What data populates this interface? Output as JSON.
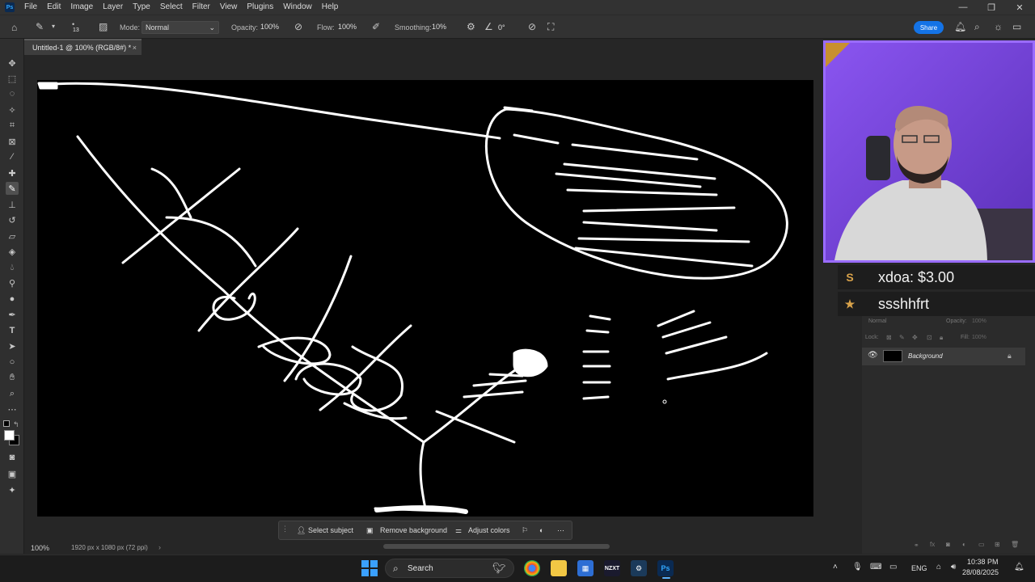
{
  "menubar": {
    "logo": "Ps",
    "items": [
      "File",
      "Edit",
      "Image",
      "Layer",
      "Type",
      "Select",
      "Filter",
      "View",
      "Plugins",
      "Window",
      "Help"
    ]
  },
  "options": {
    "brush_size": "13",
    "mode_label": "Mode:",
    "mode_value": "Normal",
    "opacity_label": "Opacity:",
    "opacity_value": "100%",
    "flow_label": "Flow:",
    "flow_value": "100%",
    "smoothing_label": "Smoothing:",
    "smoothing_value": "10%",
    "angle_value": "0°",
    "share_label": "Share"
  },
  "document": {
    "tab_title": "Untitled-1 @ 100% (RGB/8#) *",
    "zoom": "100%",
    "dimensions": "1920 px x 1080 px (72 ppi)"
  },
  "context_bar": {
    "select_subject": "Select subject",
    "remove_background": "Remove background",
    "adjust_colors": "Adjust colors"
  },
  "overlay": {
    "donation_line": "xdoa: $3.00",
    "follower_line": "ssshhfrt"
  },
  "layers": {
    "blend_mode": "Normal",
    "opacity_label": "Opacity:",
    "opacity_value": "100%",
    "lock_label": "Lock:",
    "fill_label": "Fill:",
    "fill_value": "100%",
    "layer_name": "Background"
  },
  "taskbar": {
    "search_label": "Search",
    "lang": "ENG",
    "time": "10:38 PM",
    "date": "28/08/2025",
    "nzxt": "NZXT",
    "ps": "Ps"
  },
  "colors": {
    "accent_blue": "#1473e6",
    "overlay_purple": "#6a3fd0",
    "donation_gold": "#d8a24a"
  }
}
